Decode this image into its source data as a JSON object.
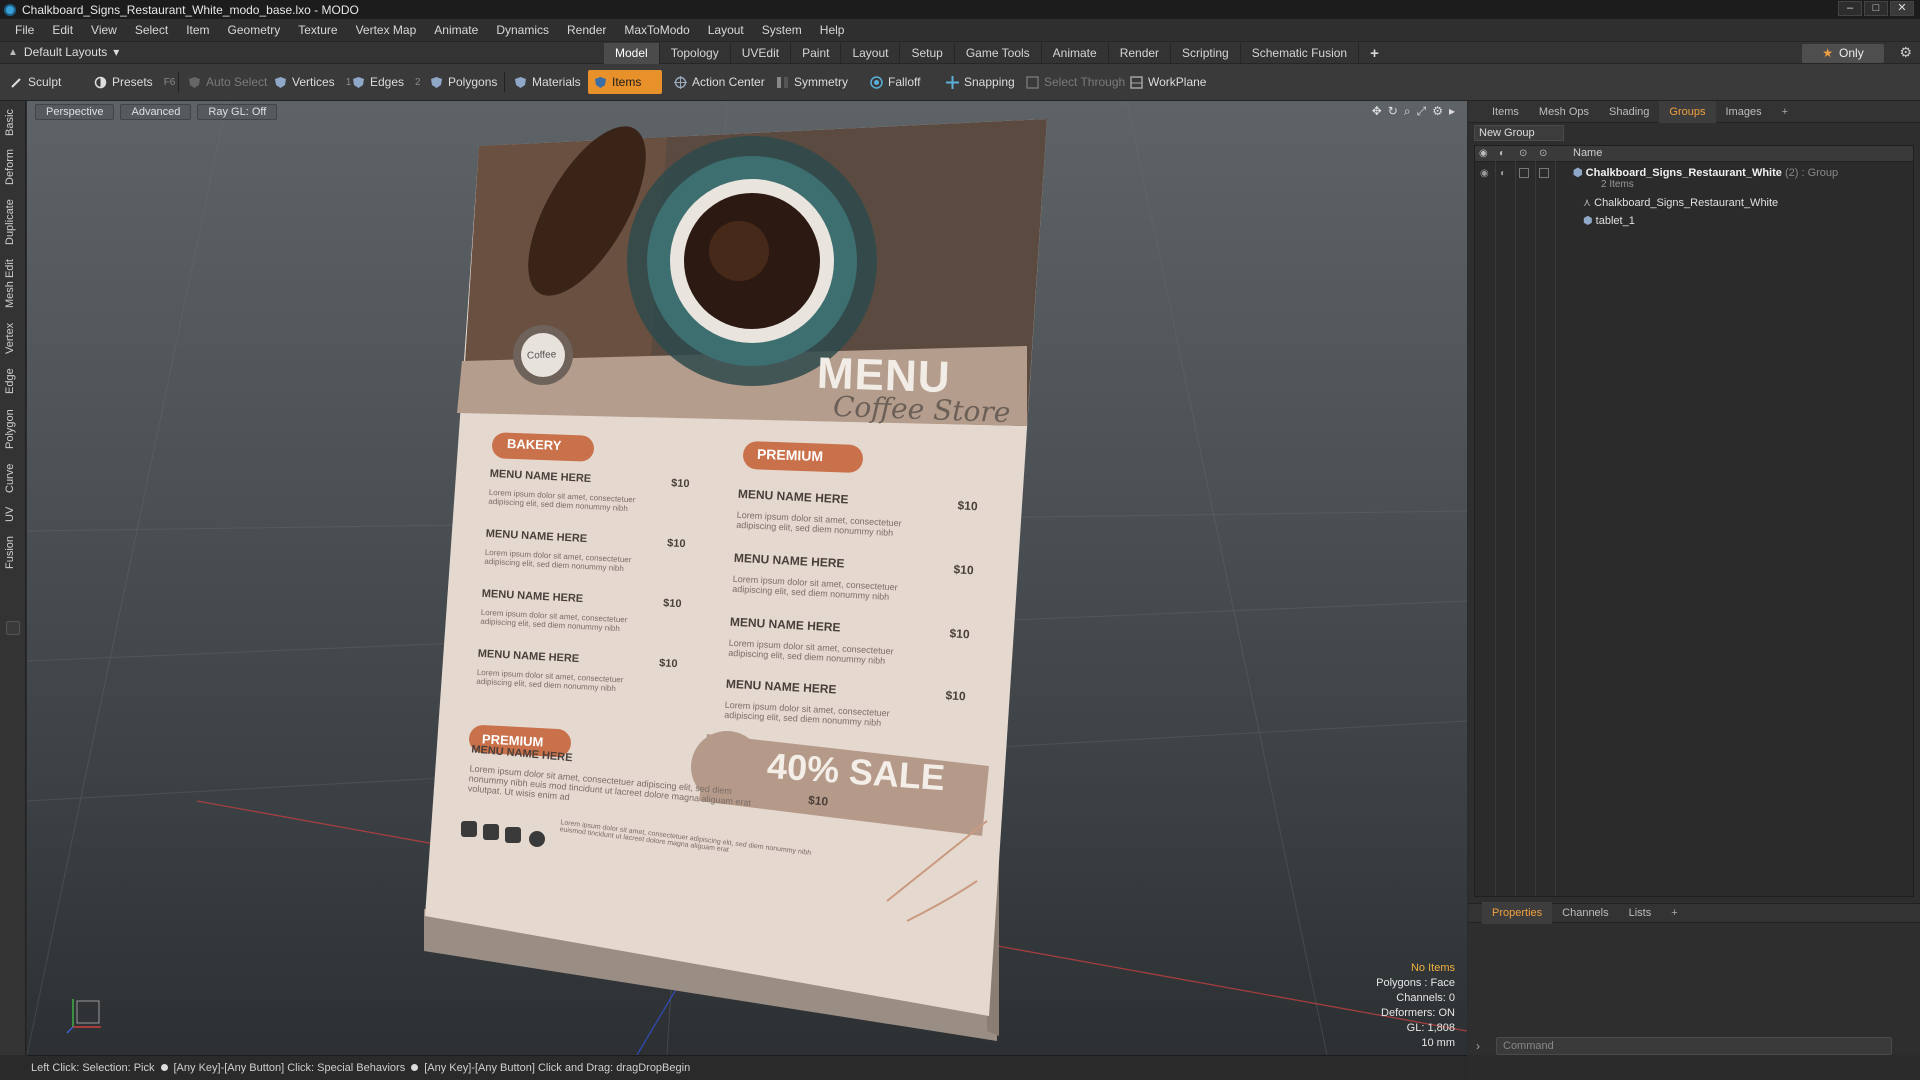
{
  "window": {
    "title": "Chalkboard_Signs_Restaurant_White_modo_base.lxo - MODO"
  },
  "menubar": [
    "File",
    "Edit",
    "View",
    "Select",
    "Item",
    "Geometry",
    "Texture",
    "Vertex Map",
    "Animate",
    "Dynamics",
    "Render",
    "MaxToModo",
    "Layout",
    "System",
    "Help"
  ],
  "layouts": {
    "label": "Default Layouts"
  },
  "layout_tabs": [
    "Model",
    "Topology",
    "UVEdit",
    "Paint",
    "Layout",
    "Setup",
    "Game Tools",
    "Animate",
    "Render",
    "Scripting",
    "Schematic Fusion"
  ],
  "only_button": "Only",
  "toolbar": {
    "sculpt": "Sculpt",
    "presets": "Presets",
    "presets_key": "F6",
    "auto_select": "Auto Select",
    "vertices": "Vertices",
    "vertices_num": "1",
    "edges": "Edges",
    "edges_num": "2",
    "polygons": "Polygons",
    "materials": "Materials",
    "items": "Items",
    "action_center": "Action Center",
    "symmetry": "Symmetry",
    "falloff": "Falloff",
    "snapping": "Snapping",
    "select_through": "Select Through",
    "workplane": "WorkPlane"
  },
  "left_tabs": [
    "Basic",
    "Deform",
    "Duplicate",
    "Mesh Edit",
    "Vertex",
    "Edge",
    "Polygon",
    "Curve",
    "UV",
    "Fusion"
  ],
  "viewport": {
    "view": "Perspective",
    "mode": "Advanced",
    "raygl": "Ray GL: Off",
    "stats": {
      "items": "No Items",
      "polygons": "Polygons : Face",
      "channels": "Channels: 0",
      "deformers": "Deformers: ON",
      "gl": "GL: 1,808",
      "unit": "10 mm"
    }
  },
  "menu_sign": {
    "coffee_badge": "Coffee",
    "title": "MENU",
    "subtitle": "Coffee Store",
    "section1": "BAKERY",
    "section2": "PREMIUM",
    "section3": "PREMIUM",
    "item_name": "MENU NAME HERE",
    "price": "$10",
    "lorem_short": "Lorem ipsum dolor sit amet, consectetuer adipiscing elit, sed diem nonummy nibh",
    "sale": "40% SALE",
    "lorem_long": "Lorem ipsum dolor sit amet, consectetuer adipiscing elit, sed diem nonummy nibh euis mod tincidunt ut lacreet dolore magna aliguam erat volutpat. Ut wisis enim ad",
    "footer_lorem": "Lorem ipsum dolor sit amet, consectetuer adipiscing elit, sed diem nonummy nibh euismod tincidunt ut lacreet dolore magna aliguam erat"
  },
  "right_panel": {
    "tabs": [
      "Items",
      "Mesh Ops",
      "Shading",
      "Groups",
      "Images"
    ],
    "active_tab": "Groups",
    "new_group": "New Group",
    "col_name": "Name",
    "group_name": "Chalkboard_Signs_Restaurant_White",
    "group_meta": "(2) : Group",
    "group_count": "2 Items",
    "child1": "Chalkboard_Signs_Restaurant_White",
    "child2": "tablet_1",
    "bottom_tabs": [
      "Properties",
      "Channels",
      "Lists"
    ],
    "command_placeholder": "Command"
  },
  "statusbar": {
    "part1": "Left Click: Selection: Pick",
    "part2": "[Any Key]-[Any Button] Click: Special Behaviors",
    "part3": "[Any Key]-[Any Button] Click and Drag: dragDropBegin"
  },
  "colors": {
    "accent": "#e8902a",
    "menu_accent": "#c9714a",
    "paper": "#e4d8cf"
  }
}
